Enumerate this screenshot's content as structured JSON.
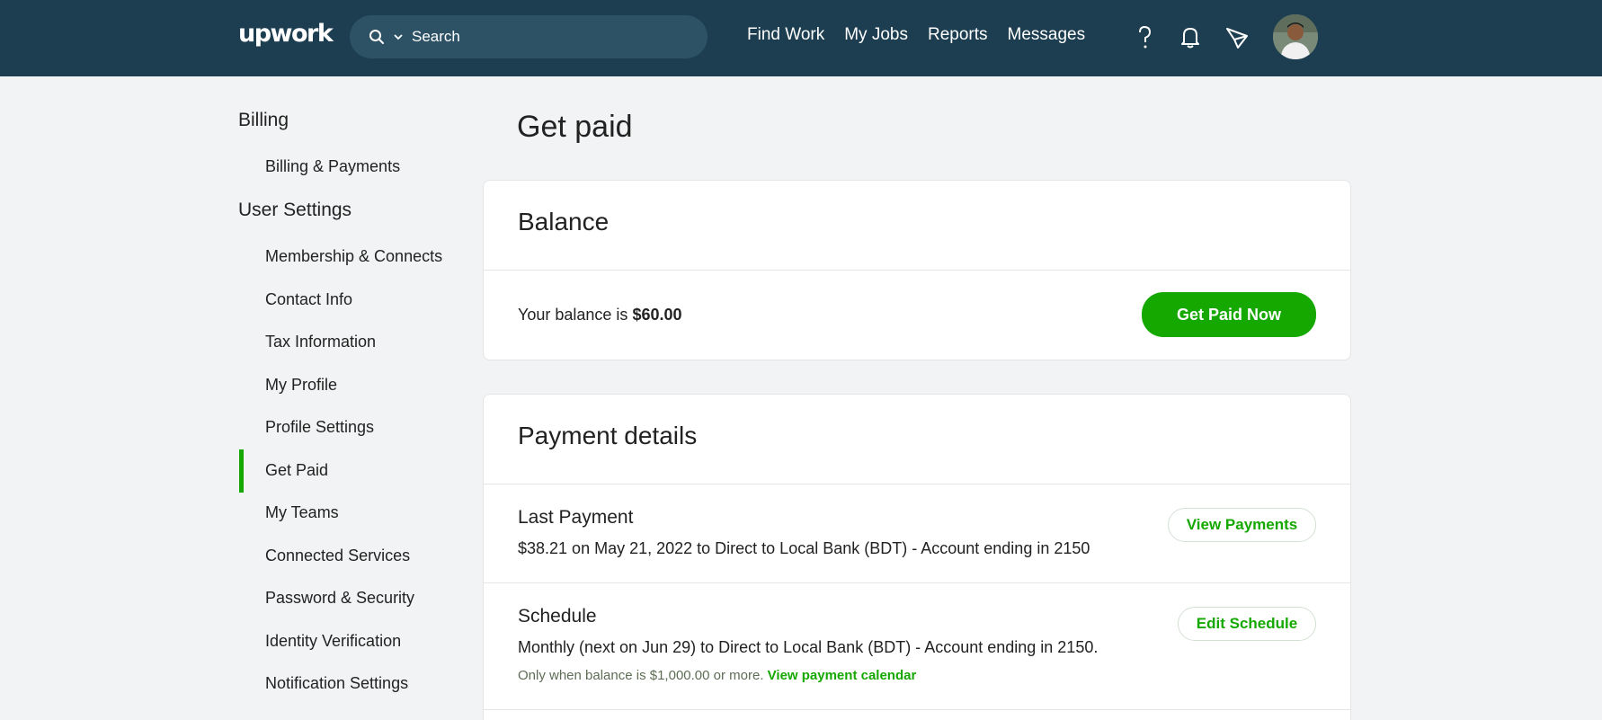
{
  "header": {
    "logo": "upwork",
    "search_placeholder": "Search",
    "nav": [
      "Find Work",
      "My Jobs",
      "Reports",
      "Messages"
    ]
  },
  "sidebar": {
    "billing_heading": "Billing",
    "billing_items": [
      "Billing & Payments"
    ],
    "user_settings_heading": "User Settings",
    "items": [
      "Membership & Connects",
      "Contact Info",
      "Tax Information",
      "My Profile",
      "Profile Settings",
      "Get Paid",
      "My Teams",
      "Connected Services",
      "Password & Security",
      "Identity Verification",
      "Notification Settings"
    ],
    "active": "Get Paid"
  },
  "main": {
    "page_title": "Get paid",
    "balance": {
      "title": "Balance",
      "label": "Your balance is",
      "amount": "$60.00",
      "button": "Get Paid Now"
    },
    "payment_details": {
      "title": "Payment details",
      "last_payment": {
        "heading": "Last Payment",
        "text": "$38.21 on May 21, 2022 to Direct to Local Bank (BDT) - Account ending in 2150",
        "button": "View Payments"
      },
      "schedule": {
        "heading": "Schedule",
        "text": "Monthly (next on Jun 29) to Direct to Local Bank (BDT) - Account ending in 2150.",
        "note": "Only when balance is $1,000.00 or more.",
        "link": "View payment calendar",
        "button": "Edit Schedule"
      }
    }
  },
  "colors": {
    "header_bg": "#1c3e50",
    "accent": "#14a800",
    "page_bg": "#f2f3f4"
  }
}
